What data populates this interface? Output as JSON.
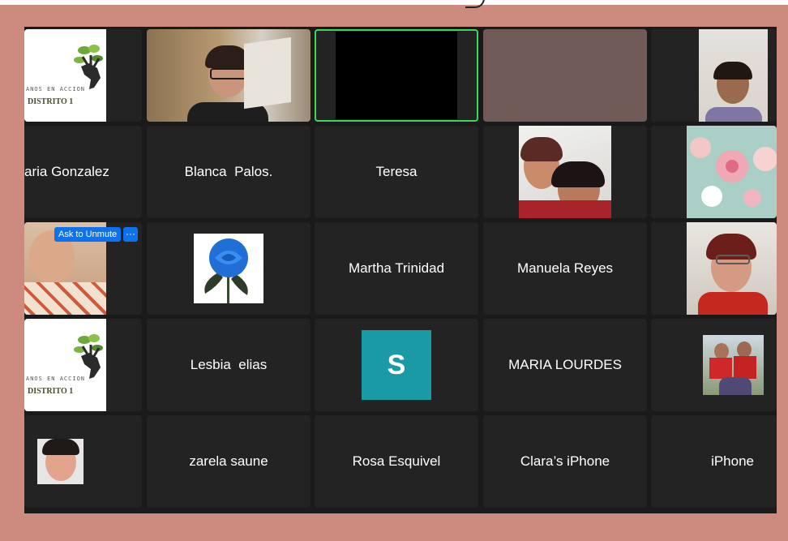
{
  "meeting": {
    "tiles": [
      {
        "name": "",
        "kind": "logo"
      },
      {
        "name": "",
        "kind": "video"
      },
      {
        "name": "",
        "kind": "video-black"
      },
      {
        "name": "",
        "kind": "video-blurred"
      },
      {
        "name": "",
        "kind": "video"
      },
      {
        "name": "aria Gonzalez",
        "kind": "name"
      },
      {
        "name": "Blanca  Palos.",
        "kind": "name"
      },
      {
        "name": "Teresa",
        "kind": "name"
      },
      {
        "name": "",
        "kind": "photo"
      },
      {
        "name": "",
        "kind": "photo"
      },
      {
        "name": "",
        "kind": "video"
      },
      {
        "name": "",
        "kind": "photo"
      },
      {
        "name": "Martha Trinidad",
        "kind": "name"
      },
      {
        "name": "Manuela Reyes",
        "kind": "name"
      },
      {
        "name": "",
        "kind": "video"
      },
      {
        "name": "",
        "kind": "logo"
      },
      {
        "name": "Lesbia  elias",
        "kind": "name"
      },
      {
        "name": "",
        "kind": "avatar"
      },
      {
        "name": "MARIA LOURDES",
        "kind": "name"
      },
      {
        "name": "",
        "kind": "photo"
      },
      {
        "name": "",
        "kind": "photo"
      },
      {
        "name": "zarela saune",
        "kind": "name"
      },
      {
        "name": "Rosa Esquivel",
        "kind": "name"
      },
      {
        "name": "Clara’s iPhone",
        "kind": "name"
      },
      {
        "name": "iPhone",
        "kind": "name"
      }
    ],
    "ask_to_unmute_label": "Ask to Unmute",
    "more_label": "···",
    "avatar_letter": "S",
    "logo_line1": "ANOS EN ACCION",
    "logo_line2": "DISTRITO  1"
  },
  "colors": {
    "background": "#cd8b7f",
    "tile": "#232323",
    "active_speaker": "#3fd45c",
    "button_blue": "#0e72ed",
    "avatar": "#1a9aa5"
  }
}
